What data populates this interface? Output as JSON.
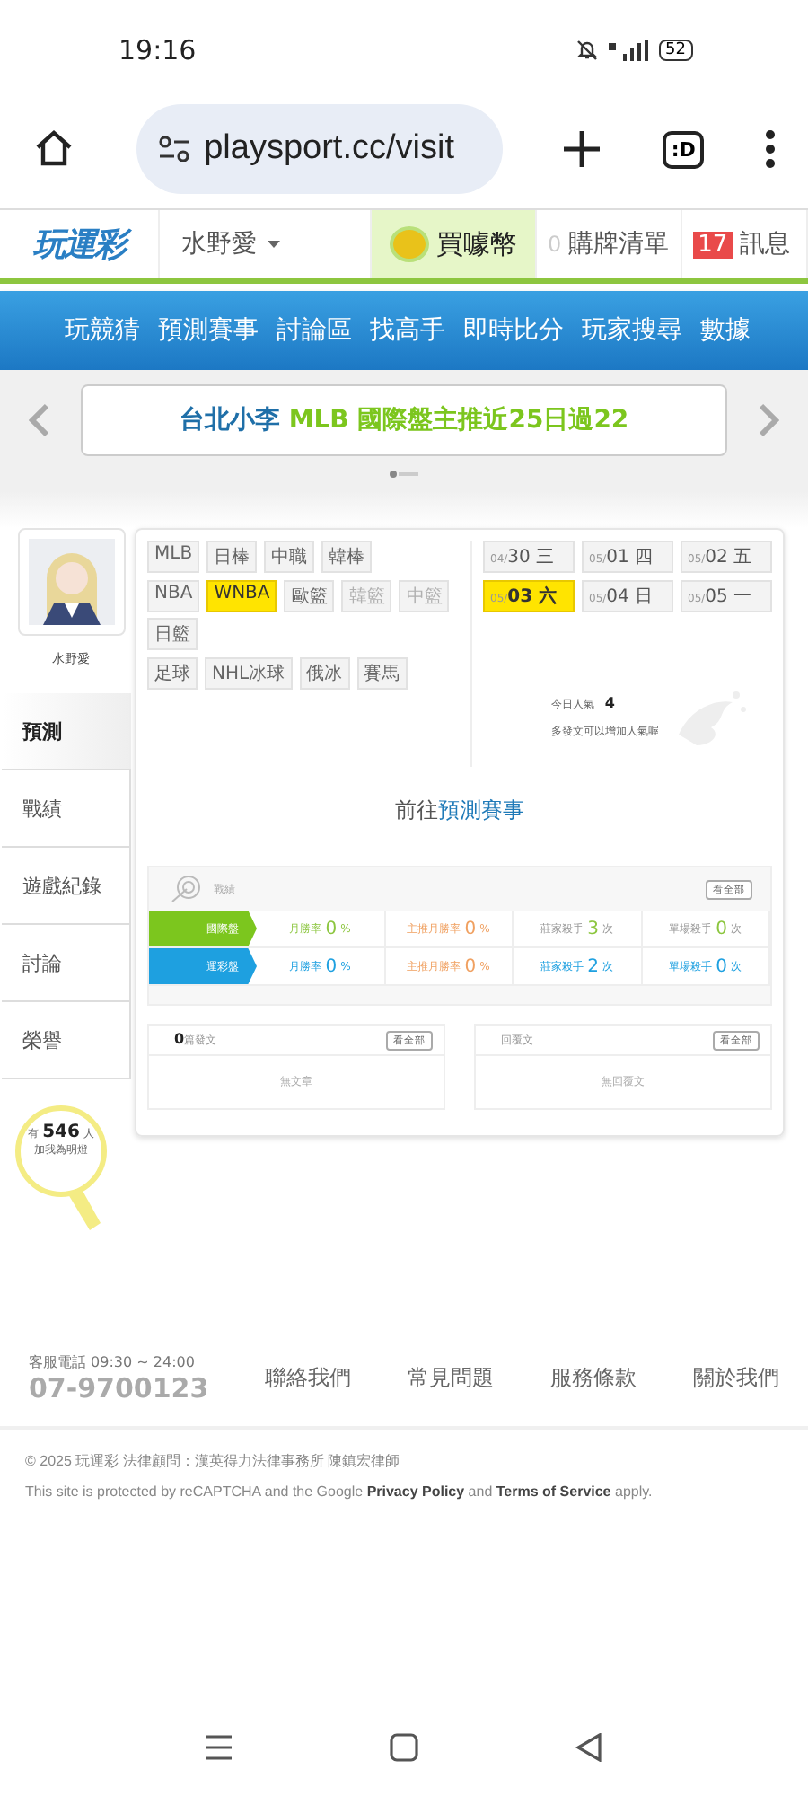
{
  "status_bar": {
    "time": "19:16",
    "battery": "52"
  },
  "browser": {
    "url": "playsport.cc/visit",
    "tab_label": ":D"
  },
  "site_header": {
    "logo": "玩運彩",
    "user": "水野愛",
    "coin_button": "買噱幣",
    "cart_count": "0",
    "cart_label": "購牌清單",
    "message_count": "17",
    "message_label": "訊息"
  },
  "nav": [
    "玩競猜",
    "預測賽事",
    "討論區",
    "找高手",
    "即時比分",
    "玩家搜尋",
    "數據"
  ],
  "banner": {
    "author": "台北小李",
    "headline": "MLB 國際盤主推近25日過22"
  },
  "profile": {
    "name": "水野愛"
  },
  "sidebar": [
    {
      "label": "預測",
      "selected": true
    },
    {
      "label": "戰績",
      "selected": false
    },
    {
      "label": "遊戲紀錄",
      "selected": false
    },
    {
      "label": "討論",
      "selected": false
    },
    {
      "label": "榮譽",
      "selected": false
    }
  ],
  "fans": {
    "prefix": "有",
    "count": "546",
    "suffix": "人",
    "caption": "加我為明燈"
  },
  "sport_rows": [
    [
      {
        "label": "MLB",
        "selected": false,
        "disabled": false
      },
      {
        "label": "日棒",
        "selected": false,
        "disabled": false
      },
      {
        "label": "中職",
        "selected": false,
        "disabled": false
      },
      {
        "label": "韓棒",
        "selected": false,
        "disabled": false
      }
    ],
    [
      {
        "label": "NBA",
        "selected": false,
        "disabled": false
      },
      {
        "label": "WNBA",
        "selected": true,
        "disabled": false
      },
      {
        "label": "歐籃",
        "selected": false,
        "disabled": false
      },
      {
        "label": "韓籃",
        "selected": false,
        "disabled": true
      },
      {
        "label": "中籃",
        "selected": false,
        "disabled": true
      },
      {
        "label": "日籃",
        "selected": false,
        "disabled": false
      }
    ],
    [
      {
        "label": "足球",
        "selected": false,
        "disabled": false
      },
      {
        "label": "NHL冰球",
        "selected": false,
        "disabled": false
      },
      {
        "label": "俄冰",
        "selected": false,
        "disabled": false
      },
      {
        "label": "賽馬",
        "selected": false,
        "disabled": false
      }
    ]
  ],
  "dates": [
    {
      "month": "04/",
      "day": "30 三",
      "selected": false
    },
    {
      "month": "05/",
      "day": "01 四",
      "selected": false
    },
    {
      "month": "05/",
      "day": "02 五",
      "selected": false
    },
    {
      "month": "05/",
      "day": "03 六",
      "selected": true
    },
    {
      "month": "05/",
      "day": "04 日",
      "selected": false
    },
    {
      "month": "05/",
      "day": "05 一",
      "selected": false
    }
  ],
  "popularity": {
    "label": "今日人氣",
    "value": "4",
    "hint": "多發文可以增加人氣喔"
  },
  "goto": {
    "prefix": "前往",
    "link": "預測賽事"
  },
  "record": {
    "title": "戰績",
    "view_all": "看全部",
    "rows": [
      {
        "label": "國際盤",
        "color": "#7cc61e",
        "cells": [
          {
            "label": "月勝率",
            "value": "0",
            "unit": "%"
          },
          {
            "label": "主推月勝率",
            "value": "0",
            "unit": "%"
          },
          {
            "label": "莊家殺手",
            "value": "3",
            "unit": "次"
          },
          {
            "label": "單場殺手",
            "value": "0",
            "unit": "次"
          }
        ]
      },
      {
        "label": "運彩盤",
        "color": "#1ea0e0",
        "cells": [
          {
            "label": "月勝率",
            "value": "0",
            "unit": "%"
          },
          {
            "label": "主推月勝率",
            "value": "0",
            "unit": "%"
          },
          {
            "label": "莊家殺手",
            "value": "2",
            "unit": "次"
          },
          {
            "label": "單場殺手",
            "value": "0",
            "unit": "次"
          }
        ]
      }
    ]
  },
  "posts": [
    {
      "count": "0",
      "title": "篇發文",
      "view_all": "看全部",
      "empty": "無文章"
    },
    {
      "title": "回覆文",
      "view_all": "看全部",
      "empty": "無回覆文"
    }
  ],
  "footer": {
    "hotline_label": "客服電話 09:30 ~ 24:00",
    "phone": "07-9700123",
    "links": [
      "聯絡我們",
      "常見問題",
      "服務條款",
      "關於我們"
    ],
    "copyright": "© 2025 玩運彩 法律顧問：漢英得力法律事務所 陳鎮宏律師",
    "recaptcha": "This site is protected by reCAPTCHA and the Google **Privacy Policy** and **Terms of Service** apply."
  }
}
